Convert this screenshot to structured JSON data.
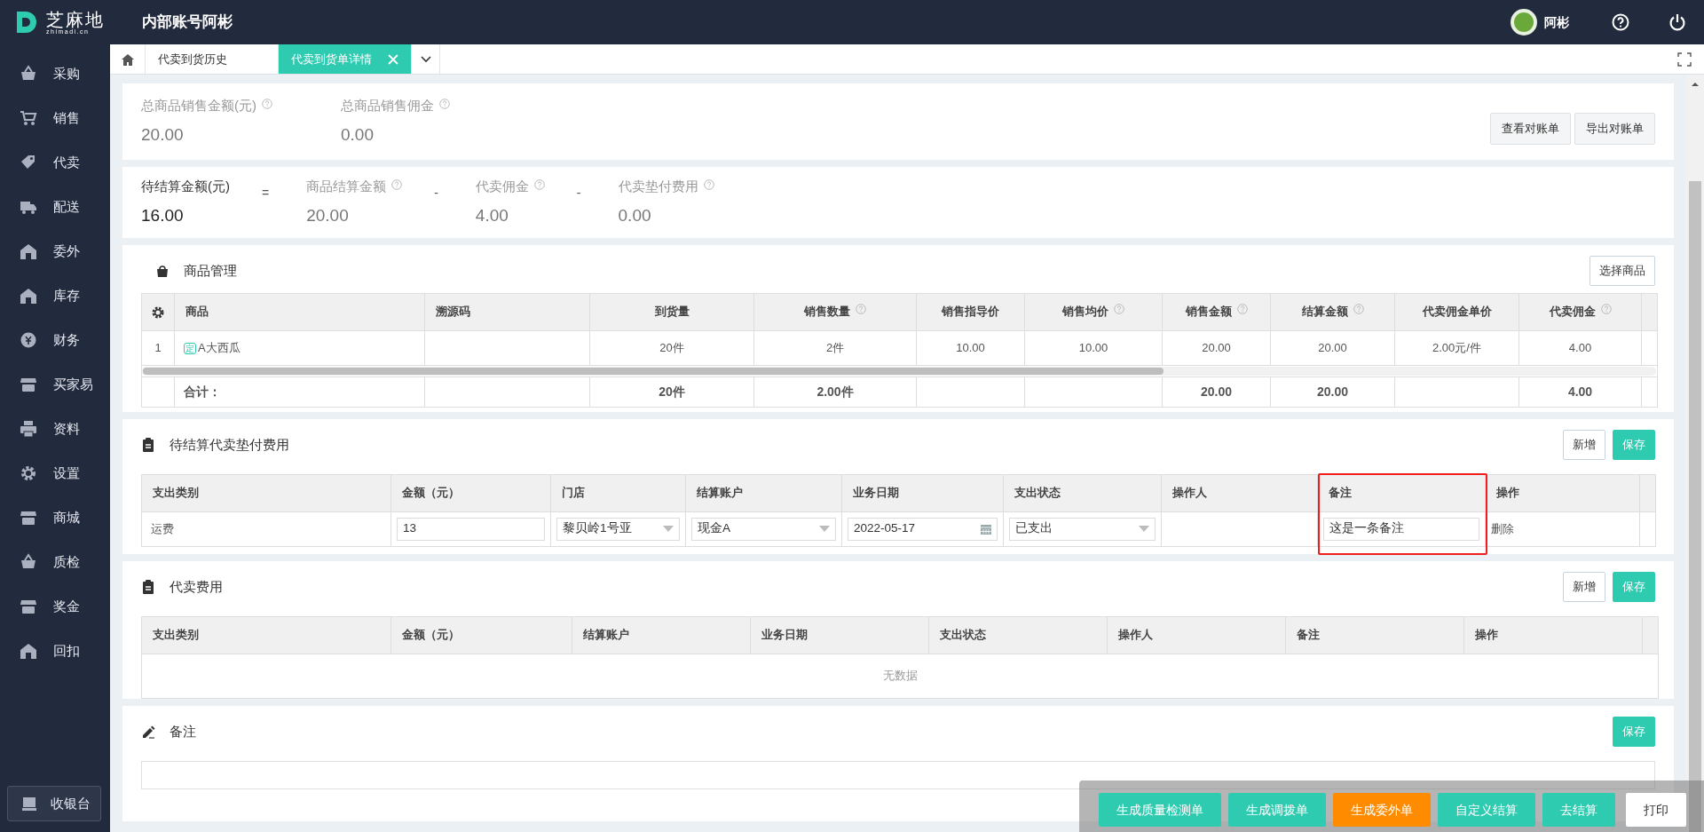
{
  "header": {
    "logo_name": "芝麻地",
    "logo_domain": "zhimadi.cn",
    "account": "内部账号阿彬",
    "user": "阿彬"
  },
  "sidebar": {
    "items": [
      {
        "label": "采购"
      },
      {
        "label": "销售"
      },
      {
        "label": "代卖"
      },
      {
        "label": "配送"
      },
      {
        "label": "委外"
      },
      {
        "label": "库存"
      },
      {
        "label": "财务"
      },
      {
        "label": "买家易"
      },
      {
        "label": "资料"
      },
      {
        "label": "设置"
      },
      {
        "label": "商城"
      },
      {
        "label": "质检"
      },
      {
        "label": "奖金"
      },
      {
        "label": "回扣"
      }
    ],
    "footer_button": "收银台"
  },
  "tabs": [
    {
      "label": "代卖到货历史",
      "selected": false,
      "closable": false
    },
    {
      "label": "代卖到货单详情",
      "selected": true,
      "closable": true
    }
  ],
  "summary": {
    "stats": [
      {
        "label": "总商品销售金额(元)",
        "value": "20.00",
        "help": true
      },
      {
        "label": "总商品销售佣金",
        "value": "0.00",
        "help": true
      }
    ],
    "buttons": [
      "查看对账单",
      "导出对账单"
    ]
  },
  "settlement": {
    "terms": [
      {
        "kind": "result",
        "label": "待结算金额(元)",
        "value": "16.00",
        "help": false
      },
      {
        "kind": "operator",
        "label": "="
      },
      {
        "kind": "term",
        "label": "商品结算金额",
        "value": "20.00",
        "help": true
      },
      {
        "kind": "operator",
        "label": "-"
      },
      {
        "kind": "term",
        "label": "代卖佣金",
        "value": "4.00",
        "help": true
      },
      {
        "kind": "operator",
        "label": "-"
      },
      {
        "kind": "term",
        "label": "代卖垫付费用",
        "value": "0.00",
        "help": true
      }
    ]
  },
  "products": {
    "title": "商品管理",
    "button": "选择商品",
    "columns": [
      {
        "label": "商品",
        "help": false
      },
      {
        "label": "溯源码",
        "help": false
      },
      {
        "label": "到货量",
        "help": false
      },
      {
        "label": "销售数量",
        "help": true
      },
      {
        "label": "销售指导价",
        "help": false
      },
      {
        "label": "销售均价",
        "help": true
      },
      {
        "label": "销售金额",
        "help": true
      },
      {
        "label": "结算金额",
        "help": true
      },
      {
        "label": "代卖佣金单价",
        "help": false
      },
      {
        "label": "代卖佣金",
        "help": true
      }
    ],
    "rows": [
      {
        "index": "1",
        "tag": "定",
        "cells": [
          "A大西瓜",
          "",
          "20件",
          "2件",
          "10.00",
          "10.00",
          "20.00",
          "20.00",
          "2.00元/件",
          "4.00"
        ]
      }
    ],
    "totals": {
      "cells": [
        "合计：",
        "",
        "20件",
        "2.00件",
        "",
        "",
        "20.00",
        "20.00",
        "",
        "4.00"
      ]
    }
  },
  "fees": {
    "title": "待结算代卖垫付费用",
    "buttons": [
      {
        "label": "新增",
        "kind": "outline"
      },
      {
        "label": "保存",
        "kind": "primary"
      }
    ],
    "columns": [
      {
        "label": "支出类别",
        "highlighted": false
      },
      {
        "label": "金额（元）",
        "highlighted": false
      },
      {
        "label": "门店",
        "highlighted": false
      },
      {
        "label": "结算账户",
        "highlighted": false
      },
      {
        "label": "业务日期",
        "highlighted": false
      },
      {
        "label": "支出状态",
        "highlighted": false
      },
      {
        "label": "操作人",
        "highlighted": false
      },
      {
        "label": "备注",
        "highlighted": true
      },
      {
        "label": "操作",
        "highlighted": false
      }
    ],
    "rows": [
      {
        "cells": [
          {
            "kind": "text",
            "value": "运费"
          },
          {
            "kind": "input",
            "value": "13"
          },
          {
            "kind": "select",
            "value": "黎贝岭1号亚"
          },
          {
            "kind": "select",
            "value": "现金A"
          },
          {
            "kind": "date",
            "value": "2022-05-17"
          },
          {
            "kind": "select",
            "value": "已支出"
          },
          {
            "kind": "text"
          },
          {
            "kind": "input",
            "value": "这是一条备注"
          },
          {
            "kind": "link",
            "value": "删除"
          }
        ]
      }
    ]
  },
  "consign_fees": {
    "title": "代卖费用",
    "buttons": [
      {
        "label": "新增",
        "kind": "outline"
      },
      {
        "label": "保存",
        "kind": "primary"
      }
    ],
    "columns": [
      {
        "label": "支出类别"
      },
      {
        "label": "金额（元）"
      },
      {
        "label": "结算账户"
      },
      {
        "label": "业务日期"
      },
      {
        "label": "支出状态"
      },
      {
        "label": "操作人"
      },
      {
        "label": "备注"
      },
      {
        "label": "操作"
      }
    ],
    "empty_text": "无数据"
  },
  "notes": {
    "title": "备注",
    "buttons": [
      {
        "label": "保存",
        "kind": "primary"
      }
    ]
  },
  "action_bar": [
    {
      "label": "生成质量检测单",
      "kind": "teal"
    },
    {
      "label": "生成调拨单",
      "kind": "teal"
    },
    {
      "label": "生成委外单",
      "kind": "orange"
    },
    {
      "label": "自定义结算",
      "kind": "teal"
    },
    {
      "label": "去结算",
      "kind": "teal"
    },
    {
      "label": "打印",
      "kind": "plain"
    }
  ]
}
